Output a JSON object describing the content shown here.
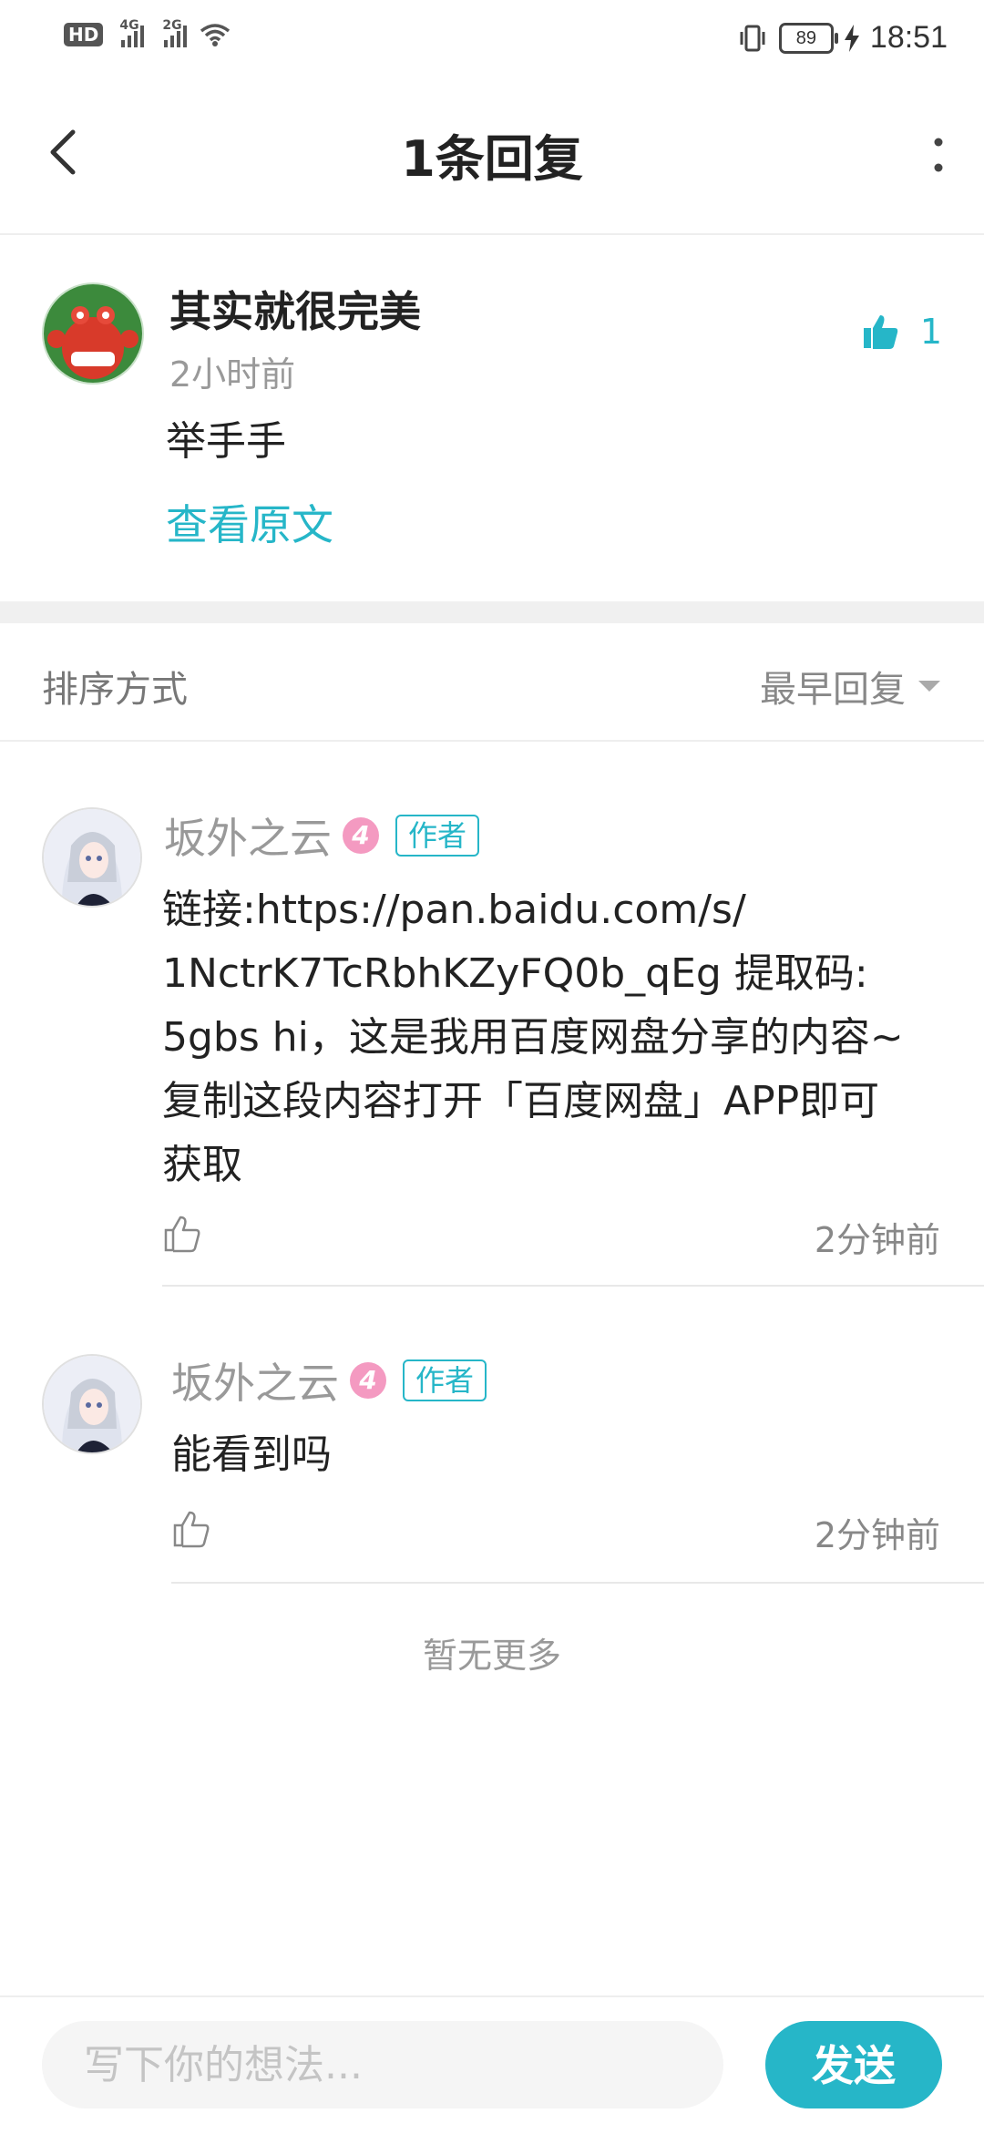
{
  "status_bar": {
    "hd": "HD",
    "signal1_label": "4G",
    "signal2_label": "2G",
    "battery": "89",
    "time": "18:51"
  },
  "header": {
    "title": "1条回复",
    "back_icon": "chevron-left-icon",
    "more_icon": "more-vertical-icon"
  },
  "main_comment": {
    "author": "其实就很完美",
    "time": "2小时前",
    "text": "举手手",
    "link": "查看原文",
    "likes": "1"
  },
  "sort": {
    "label": "排序方式",
    "selected": "最早回复"
  },
  "replies": [
    {
      "author": "坂外之云",
      "level": "4",
      "tag": "作者",
      "lines": [
        "链接:https://pan.baidu.com/s/",
        "1NctrK7TcRbhKZyFQ0b_qEg 提取码:",
        "5gbs hi，这是我用百度网盘分享的内容~",
        "复制这段内容打开「百度网盘」APP即可",
        "获取"
      ],
      "time": "2分钟前"
    },
    {
      "author": "坂外之云",
      "level": "4",
      "tag": "作者",
      "lines": [
        "能看到吗"
      ],
      "time": "2分钟前"
    }
  ],
  "no_more": "暂无更多",
  "composer": {
    "placeholder": "写下你的想法...",
    "send_label": "发送"
  },
  "colors": {
    "accent": "#26b6c8",
    "level_badge": "#f49ac1"
  }
}
